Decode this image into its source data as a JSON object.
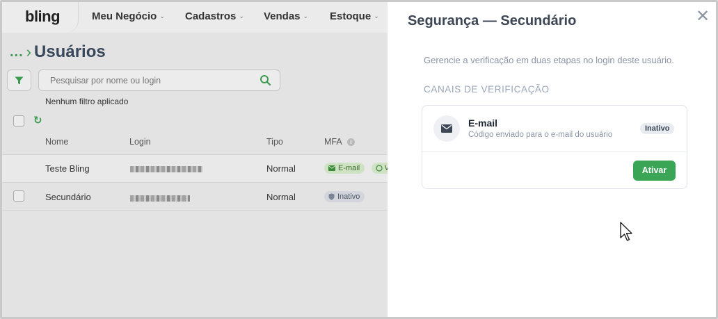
{
  "app": {
    "logo": "bling"
  },
  "nav": [
    {
      "label": "Meu Negócio"
    },
    {
      "label": "Cadastros"
    },
    {
      "label": "Vendas"
    },
    {
      "label": "Estoque"
    }
  ],
  "breadcrumb": {
    "ellipsis": "...",
    "title": "Usuários"
  },
  "search": {
    "placeholder": "Pesquisar por nome ou login"
  },
  "filters": {
    "status": "Nenhum filtro aplicado"
  },
  "table": {
    "headers": {
      "name": "Nome",
      "login": "Login",
      "type": "Tipo",
      "mfa": "MFA"
    },
    "rows": [
      {
        "name": "Teste Bling",
        "type": "Normal",
        "mfa": [
          "E-mail",
          "W"
        ]
      },
      {
        "name": "Secundário",
        "type": "Normal",
        "mfa": [
          "Inativo"
        ]
      }
    ]
  },
  "panel": {
    "title": "Segurança — Secundário",
    "description": "Gerencie a verificação em duas etapas no login deste usuário.",
    "section": "CANAIS DE VERIFICAÇÃO",
    "channel": {
      "title": "E-mail",
      "subtitle": "Código enviado para o e-mail do usuário",
      "status": "Inativo",
      "action": "Ativar"
    }
  },
  "colors": {
    "brand_green": "#3aa655",
    "title": "#3c4655",
    "muted": "#8a94a6"
  },
  "icons": [
    "filter-icon",
    "search-icon",
    "refresh-icon",
    "info-icon",
    "mail-icon",
    "whatsapp-icon",
    "shield-icon",
    "close-icon",
    "chevron-down-icon",
    "cursor-icon"
  ]
}
